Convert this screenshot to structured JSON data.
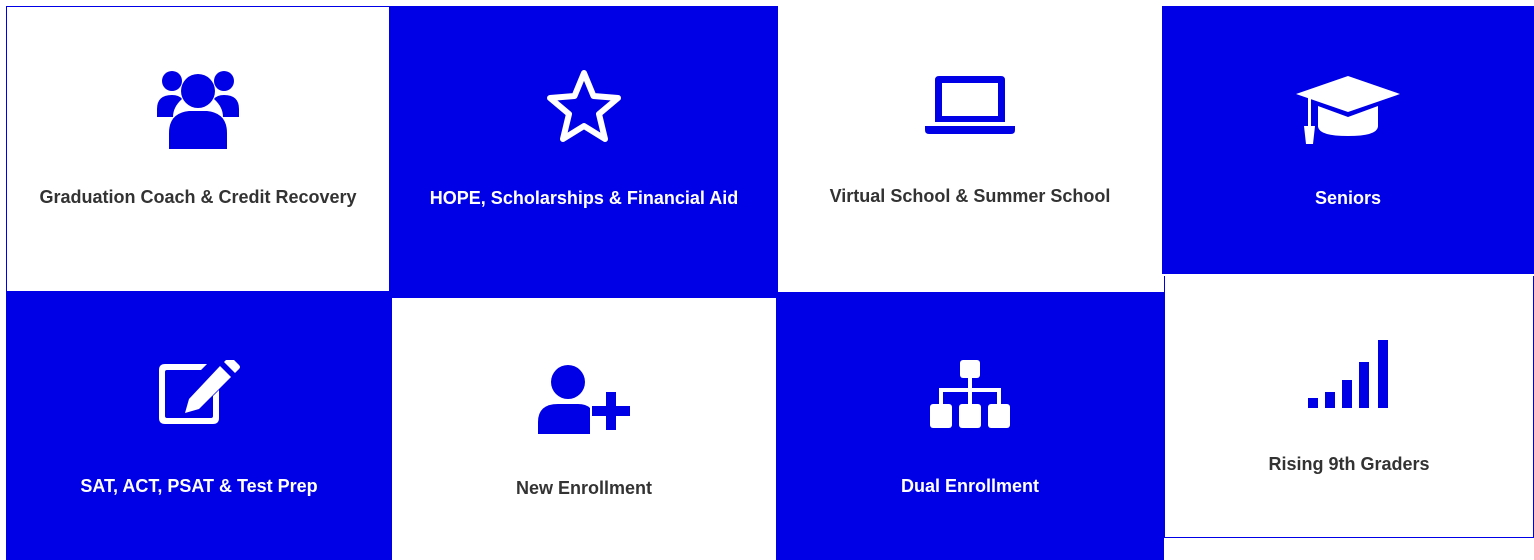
{
  "colors": {
    "accent": "#0000e6",
    "tile_white_bg": "#ffffff",
    "tile_dark_text": "#333333",
    "tile_light_text": "#ffffff"
  },
  "tiles": [
    {
      "label": "Graduation Coach & Credit Recovery",
      "icon": "users-group-icon",
      "style": "white"
    },
    {
      "label": "HOPE, Scholarships & Financial Aid",
      "icon": "star-icon",
      "style": "blue"
    },
    {
      "label": "Virtual School & Summer School",
      "icon": "laptop-icon",
      "style": "white"
    },
    {
      "label": "Seniors",
      "icon": "graduation-cap-icon",
      "style": "blue"
    },
    {
      "label": "SAT, ACT, PSAT & Test Prep",
      "icon": "edit-icon",
      "style": "blue"
    },
    {
      "label": "New Enrollment",
      "icon": "user-plus-icon",
      "style": "white"
    },
    {
      "label": "Dual Enrollment",
      "icon": "sitemap-icon",
      "style": "blue"
    },
    {
      "label": "Rising 9th Graders",
      "icon": "signal-bars-icon",
      "style": "white"
    }
  ]
}
